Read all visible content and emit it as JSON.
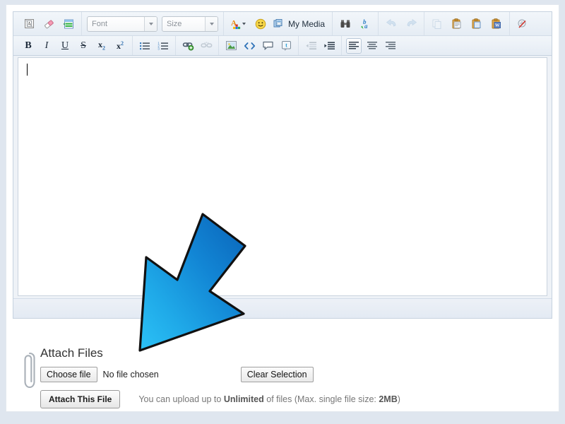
{
  "editor": {
    "toolbar_row1": [
      {
        "name": "source-view-icon",
        "label": "",
        "glyph": "source",
        "state": "normal"
      },
      {
        "name": "eraser-icon",
        "label": "",
        "glyph": "eraser",
        "state": "normal"
      },
      {
        "name": "insert-table-icon",
        "label": "",
        "glyph": "table",
        "state": "normal"
      },
      {
        "name": "font-family-select",
        "label": "Font",
        "glyph": "select",
        "state": "normal"
      },
      {
        "name": "font-size-select",
        "label": "Size",
        "glyph": "select",
        "state": "normal"
      },
      {
        "name": "text-color-icon",
        "label": "",
        "glyph": "textcolor",
        "state": "normal"
      },
      {
        "name": "emoticon-icon",
        "label": "",
        "glyph": "smiley",
        "state": "normal"
      },
      {
        "name": "my-media-button",
        "label": "My Media",
        "glyph": "media",
        "state": "normal"
      },
      {
        "name": "find-icon",
        "label": "",
        "glyph": "binoculars",
        "state": "normal"
      },
      {
        "name": "spellcheck-icon",
        "label": "",
        "glyph": "spellcheck",
        "state": "normal"
      },
      {
        "name": "undo-icon",
        "label": "",
        "glyph": "undo",
        "state": "disabled"
      },
      {
        "name": "redo-icon",
        "label": "",
        "glyph": "redo",
        "state": "disabled"
      },
      {
        "name": "copy-icon",
        "label": "",
        "glyph": "copy",
        "state": "disabled"
      },
      {
        "name": "paste-icon",
        "label": "",
        "glyph": "paste",
        "state": "normal"
      },
      {
        "name": "paste-text-icon",
        "label": "",
        "glyph": "paste-text",
        "state": "normal"
      },
      {
        "name": "paste-word-icon",
        "label": "",
        "glyph": "paste-word",
        "state": "normal"
      },
      {
        "name": "remove-format-icon",
        "label": "",
        "glyph": "broom",
        "state": "normal"
      }
    ],
    "toolbar_row2": [
      {
        "name": "bold-button",
        "label": "B",
        "glyph": "bold",
        "state": "normal"
      },
      {
        "name": "italic-button",
        "label": "I",
        "glyph": "italic",
        "state": "normal"
      },
      {
        "name": "underline-button",
        "label": "U",
        "glyph": "underline",
        "state": "normal"
      },
      {
        "name": "strikethrough-button",
        "label": "S",
        "glyph": "strike",
        "state": "normal"
      },
      {
        "name": "subscript-button",
        "label": "x",
        "glyph": "sub",
        "state": "normal"
      },
      {
        "name": "superscript-button",
        "label": "x",
        "glyph": "sup",
        "state": "normal"
      },
      {
        "name": "bulleted-list-button",
        "label": "",
        "glyph": "ul",
        "state": "normal"
      },
      {
        "name": "numbered-list-button",
        "label": "",
        "glyph": "ol",
        "state": "normal"
      },
      {
        "name": "insert-link-button",
        "label": "",
        "glyph": "link",
        "state": "normal"
      },
      {
        "name": "unlink-button",
        "label": "",
        "glyph": "unlink",
        "state": "disabled"
      },
      {
        "name": "insert-image-button",
        "label": "",
        "glyph": "image",
        "state": "normal"
      },
      {
        "name": "source-code-button",
        "label": "",
        "glyph": "code",
        "state": "normal"
      },
      {
        "name": "comment-button",
        "label": "",
        "glyph": "comment",
        "state": "normal"
      },
      {
        "name": "twitter-button",
        "label": "",
        "glyph": "twitter",
        "state": "normal"
      },
      {
        "name": "outdent-button",
        "label": "",
        "glyph": "outdent",
        "state": "disabled"
      },
      {
        "name": "indent-button",
        "label": "",
        "glyph": "indent",
        "state": "normal"
      },
      {
        "name": "align-left-button",
        "label": "",
        "glyph": "align-left",
        "state": "active"
      },
      {
        "name": "align-center-button",
        "label": "",
        "glyph": "align-center",
        "state": "normal"
      },
      {
        "name": "align-right-button",
        "label": "",
        "glyph": "align-right",
        "state": "normal"
      }
    ],
    "content_text": ""
  },
  "attach": {
    "title": "Attach Files",
    "choose_file_label": "Choose file",
    "no_file_text": "No file chosen",
    "clear_selection_label": "Clear Selection",
    "attach_this_file_label": "Attach This File",
    "hint_prefix": "You can upload up to ",
    "hint_limit": "Unlimited",
    "hint_middle": " of files (Max. single file size: ",
    "hint_size": "2MB",
    "hint_suffix": ")"
  },
  "colors": {
    "arrow_dark": "#0b6ec4",
    "arrow_light": "#22b7f2",
    "page_bg": "#dfe6ef",
    "toolbar_bg": "#e9eff6"
  }
}
